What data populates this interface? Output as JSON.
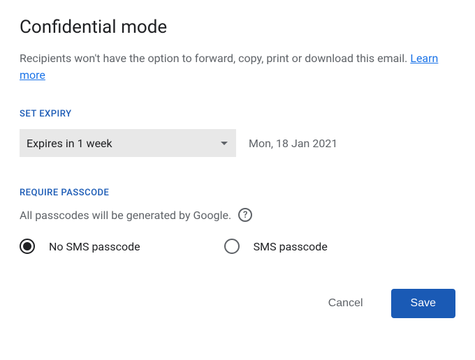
{
  "dialog": {
    "title": "Confidential mode",
    "description_text": "Recipients won't have the option to forward, copy, print or download this email. ",
    "learn_more": "Learn more"
  },
  "expiry": {
    "section_label": "SET EXPIRY",
    "selected": "Expires in 1 week",
    "date": "Mon, 18 Jan 2021"
  },
  "passcode": {
    "section_label": "REQUIRE PASSCODE",
    "note": "All passcodes will be generated by Google.",
    "help_symbol": "?",
    "options": {
      "no_sms": "No SMS passcode",
      "sms": "SMS passcode"
    }
  },
  "buttons": {
    "cancel": "Cancel",
    "save": "Save"
  }
}
